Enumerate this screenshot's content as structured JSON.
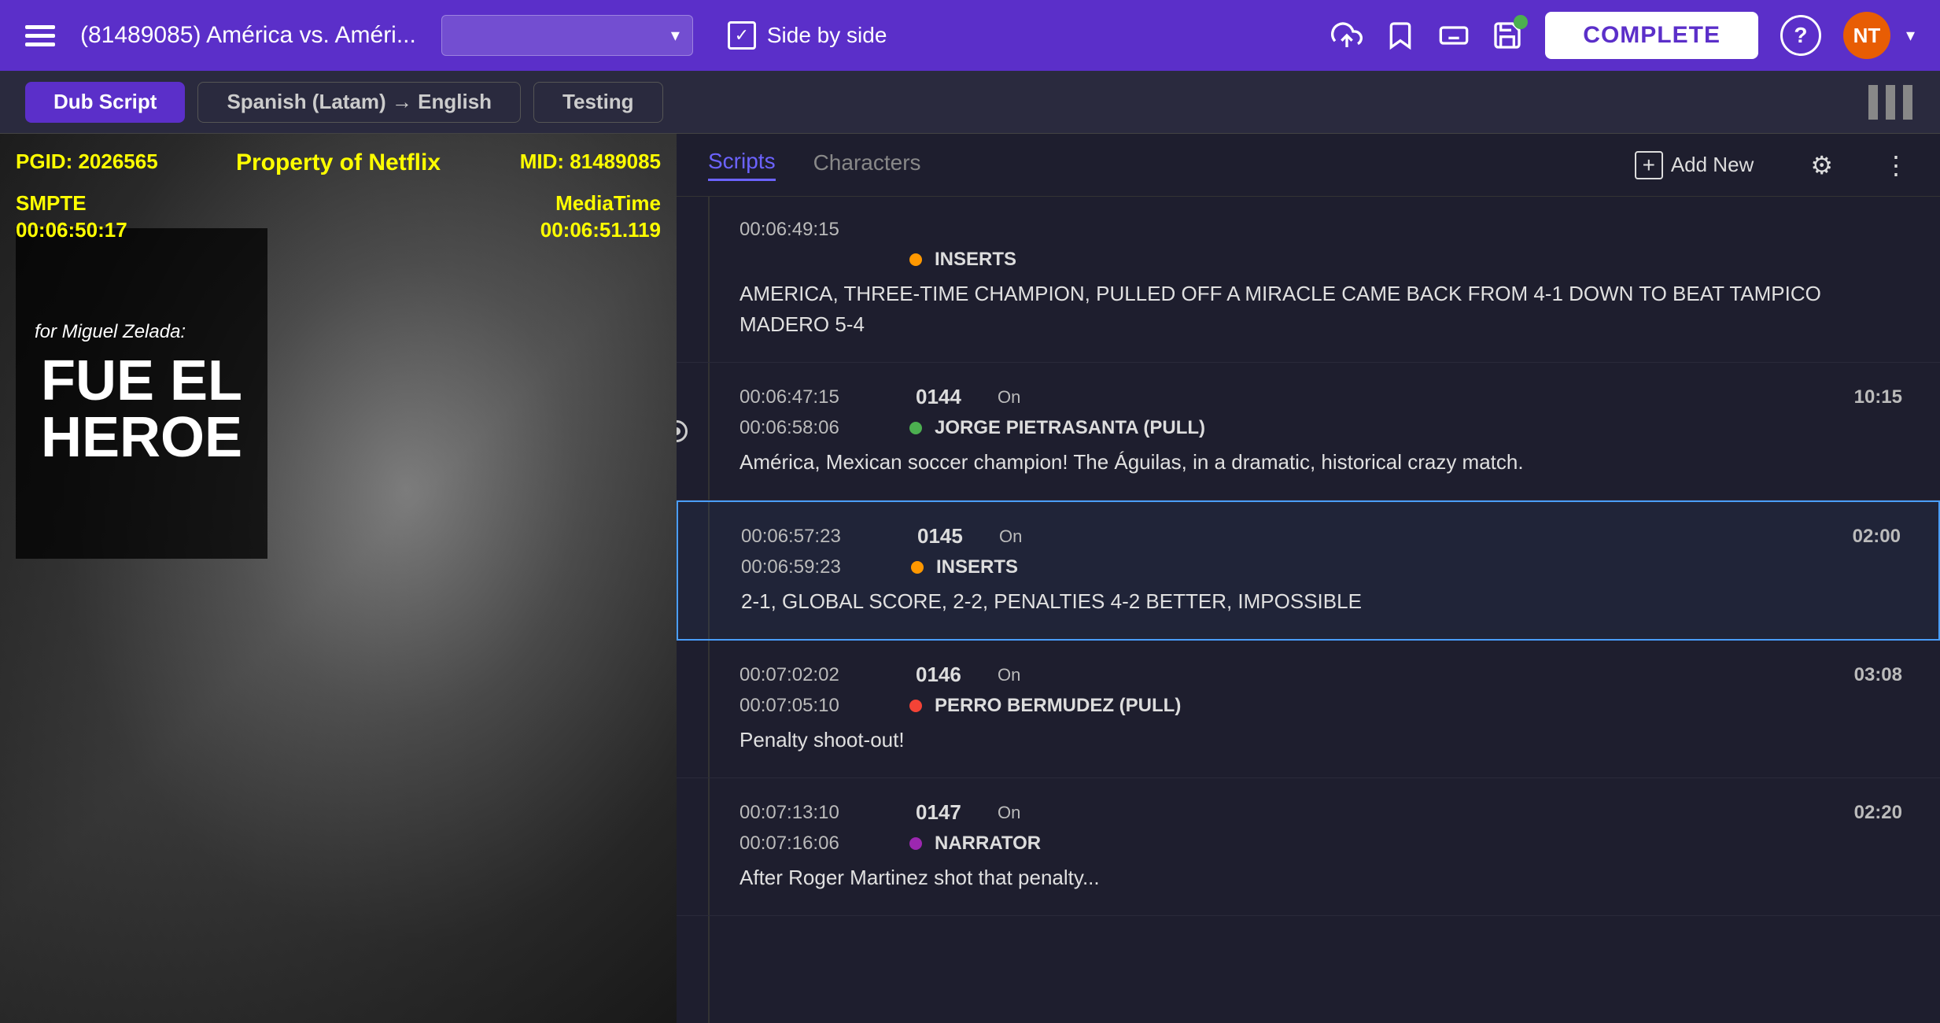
{
  "topbar": {
    "title": "(81489085) América vs. Améri...",
    "dropdown_placeholder": "",
    "side_by_side_label": "Side by side",
    "complete_label": "COMPLETE",
    "avatar_initials": "NT",
    "avatar_color": "#e85d04",
    "pgid": "PGID: 2026565",
    "netflix": "Property of Netflix",
    "mid": "MID: 81489085",
    "smpte_line1": "SMPTE",
    "smpte_line2": "00:06:50:17",
    "mediatime_line1": "MediaTime",
    "mediatime_line2": "00:06:51.119"
  },
  "secondbar": {
    "tab1": "Dub Script",
    "tab2": "Spanish (Latam) → English",
    "tab3": "Testing"
  },
  "video_card": {
    "title": "for Miguel Zelada:",
    "main_text": "FUE EL HEROE"
  },
  "scripts_panel": {
    "tab_scripts": "Scripts",
    "tab_characters": "Characters",
    "add_new_label": "Add New",
    "rows": [
      {
        "id": "row-0",
        "time_in": "00:06:49:15",
        "time_out": null,
        "seq": null,
        "on": null,
        "duration": null,
        "speaker_color": null,
        "speaker_name": "INSERTS",
        "text": "AMERICA, THREE-TIME CHAMPION, PULLED OFF A MIRACLE CAME BACK FROM 4-1 DOWN TO BEAT TAMPICO MADERO 5-4",
        "is_inserts": true,
        "active": false
      },
      {
        "id": "row-144",
        "time_in": "00:06:47:15",
        "time_out": "00:06:58:06",
        "seq": "0144",
        "on": "On",
        "duration": "10:15",
        "speaker_color": "green",
        "speaker_name": "JORGE PIETRASANTA (PULL)",
        "text": "América, Mexican soccer champion! The Águilas, in a dramatic, historical crazy match.",
        "is_inserts": false,
        "active": false
      },
      {
        "id": "row-145",
        "time_in": "00:06:57:23",
        "time_out": "00:06:59:23",
        "seq": "0145",
        "on": "On",
        "duration": "02:00",
        "speaker_color": "orange",
        "speaker_name": "INSERTS",
        "text": "2-1, GLOBAL SCORE, 2-2, PENALTIES 4-2 BETTER, IMPOSSIBLE",
        "is_inserts": true,
        "active": true
      },
      {
        "id": "row-146",
        "time_in": "00:07:02:02",
        "time_out": "00:07:05:10",
        "seq": "0146",
        "on": "On",
        "duration": "03:08",
        "speaker_color": "red",
        "speaker_name": "PERRO BERMUDEZ (PULL)",
        "text": "Penalty shoot-out!",
        "is_inserts": false,
        "active": false
      },
      {
        "id": "row-147",
        "time_in": "00:07:13:10",
        "time_out": "00:07:16:06",
        "seq": "0147",
        "on": "On",
        "duration": "02:20",
        "speaker_color": "purple",
        "speaker_name": "NARRATOR",
        "text": "After Roger Martinez shot that penalty...",
        "is_inserts": false,
        "active": false
      }
    ]
  }
}
